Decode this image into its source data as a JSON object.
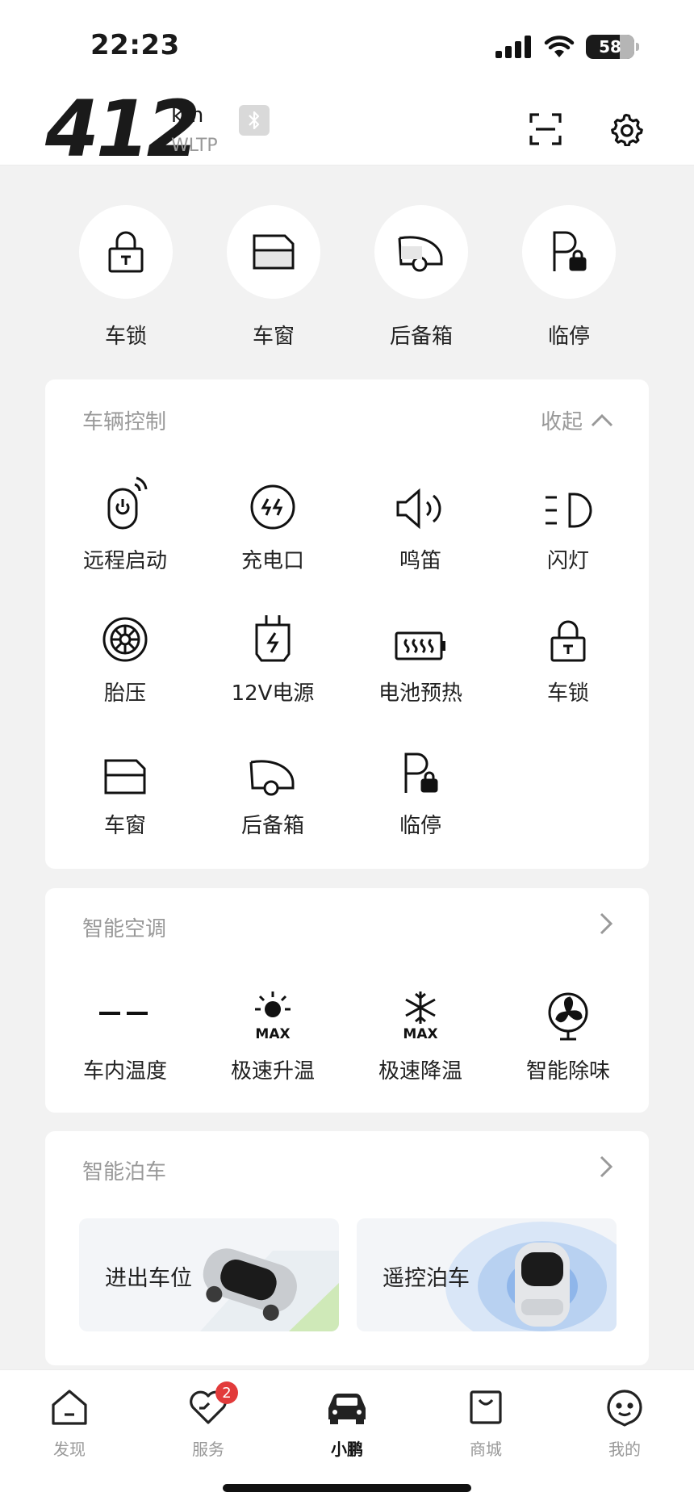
{
  "status_bar": {
    "time": "22:23",
    "battery": "58"
  },
  "header": {
    "range_value": "412",
    "range_unit": "km",
    "range_standard": "WLTP"
  },
  "quick_actions": [
    {
      "label": "车锁",
      "icon": "lock-icon"
    },
    {
      "label": "车窗",
      "icon": "window-icon"
    },
    {
      "label": "后备箱",
      "icon": "trunk-icon"
    },
    {
      "label": "临停",
      "icon": "temp-parking-icon"
    }
  ],
  "vehicle_control": {
    "title": "车辆控制",
    "toggle_label": "收起",
    "items": [
      {
        "label": "远程启动",
        "icon": "remote-start-icon"
      },
      {
        "label": "充电口",
        "icon": "charge-port-icon"
      },
      {
        "label": "鸣笛",
        "icon": "horn-icon"
      },
      {
        "label": "闪灯",
        "icon": "headlight-icon"
      },
      {
        "label": "胎压",
        "icon": "tire-pressure-icon"
      },
      {
        "label": "12V电源",
        "icon": "power-12v-icon"
      },
      {
        "label": "电池预热",
        "icon": "battery-preheat-icon"
      },
      {
        "label": "车锁",
        "icon": "lock-icon"
      },
      {
        "label": "车窗",
        "icon": "window-icon"
      },
      {
        "label": "后备箱",
        "icon": "trunk-icon"
      },
      {
        "label": "临停",
        "icon": "temp-parking-icon"
      }
    ]
  },
  "climate": {
    "title": "智能空调",
    "items": [
      {
        "label": "车内温度",
        "value": "--"
      },
      {
        "label": "极速升温",
        "badge": "MAX"
      },
      {
        "label": "极速降温",
        "badge": "MAX"
      },
      {
        "label": "智能除味"
      }
    ]
  },
  "parking": {
    "title": "智能泊车",
    "tiles": [
      {
        "label": "进出车位"
      },
      {
        "label": "遥控泊车"
      }
    ]
  },
  "bottom_nav": [
    {
      "label": "发现",
      "icon": "home-icon"
    },
    {
      "label": "服务",
      "icon": "service-heart-icon",
      "badge": "2"
    },
    {
      "label": "小鹏",
      "icon": "car-icon",
      "active": true
    },
    {
      "label": "商城",
      "icon": "shop-bag-icon"
    },
    {
      "label": "我的",
      "icon": "profile-icon"
    }
  ],
  "colors": {
    "accent_badge": "#e23b3b",
    "background": "#f2f2f2",
    "card": "#ffffff",
    "muted_text": "#999999"
  }
}
